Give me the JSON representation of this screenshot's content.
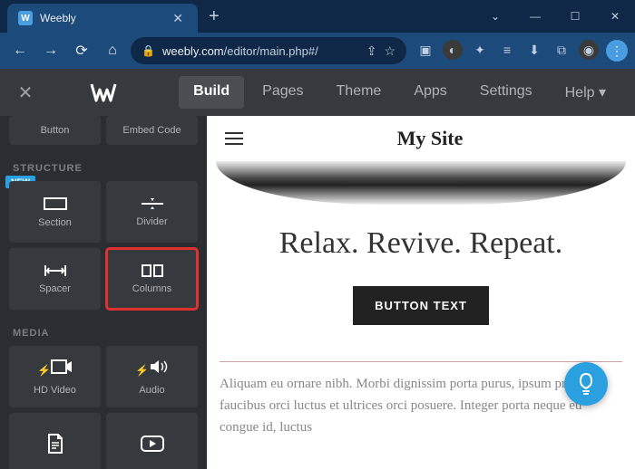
{
  "browser": {
    "tab_title": "Weebly",
    "url_domain": "weebly.com",
    "url_path": "/editor/main.php#/"
  },
  "nav": {
    "items": [
      "Build",
      "Pages",
      "Theme",
      "Apps",
      "Settings",
      "Help"
    ],
    "active": "Build"
  },
  "sidebar": {
    "top_tiles": [
      "Button",
      "Embed Code"
    ],
    "structure_label": "STRUCTURE",
    "structure_tiles": [
      "Section",
      "Divider",
      "Spacer",
      "Columns"
    ],
    "new_badge": "NEW",
    "media_label": "MEDIA",
    "media_tiles": [
      "HD Video",
      "Audio"
    ]
  },
  "site": {
    "title": "My Site",
    "hero_text": "Relax. Revive. Repeat.",
    "cta_label": "BUTTON TEXT",
    "lorem": "Aliquam eu ornare nibh. Morbi dignissim porta purus, ipsum primis in faucibus orci luctus et ultrices orci posuere. Integer porta neque eu congue id, luctus"
  }
}
